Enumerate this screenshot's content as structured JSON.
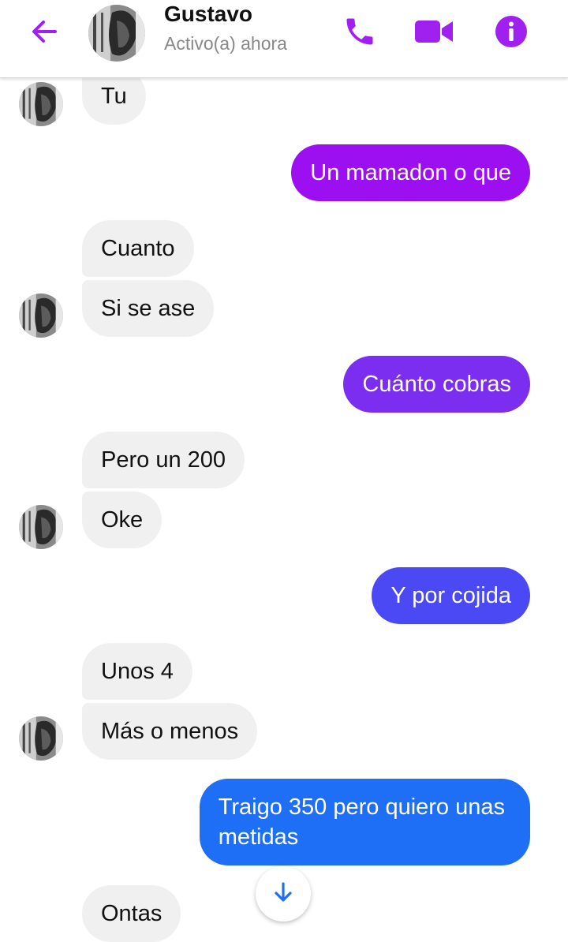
{
  "header": {
    "name": "Gustavo",
    "status": "Activo(a) ahora",
    "accent_color": "#a020f0"
  },
  "icons": {
    "back": "arrow-left-icon",
    "call": "phone-icon",
    "video": "video-camera-icon",
    "info": "info-icon",
    "scroll_down": "arrow-down-icon"
  },
  "messages": [
    {
      "from": "them",
      "text": "Tu"
    },
    {
      "from": "me",
      "text": "Un mamadon o que",
      "color": "#9b0ff0"
    },
    {
      "from": "them",
      "text": "Cuanto"
    },
    {
      "from": "them",
      "text": "Si se ase"
    },
    {
      "from": "me",
      "text": "Cuánto cobras",
      "color": "#7b2df0"
    },
    {
      "from": "them",
      "text": "Pero un 200"
    },
    {
      "from": "them",
      "text": "Oke"
    },
    {
      "from": "me",
      "text": "Y por cojida",
      "color": "#4a49f3"
    },
    {
      "from": "them",
      "text": "Unos 4"
    },
    {
      "from": "them",
      "text": "Más o menos"
    },
    {
      "from": "me",
      "text_line1": "Traigo 350 pero quiero unas",
      "text_line2": "metidas",
      "color": "#1e6ff5"
    },
    {
      "from": "them",
      "text": "Ontas"
    }
  ]
}
